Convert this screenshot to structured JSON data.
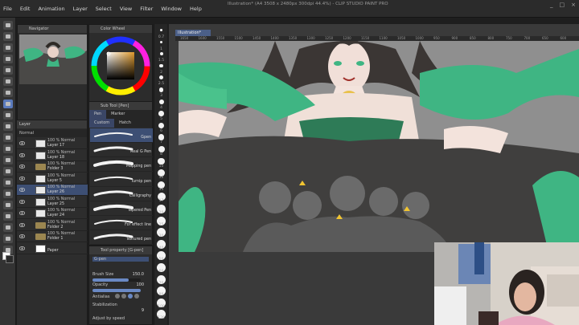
{
  "window": {
    "title": "Illustration* (A4 3508 x 2480px 300dpi 44.4%) - CLIP STUDIO PAINT PRO",
    "controls": [
      "_",
      "□",
      "×"
    ]
  },
  "menu": [
    "File",
    "Edit",
    "Animation",
    "Layer",
    "Select",
    "View",
    "Filter",
    "Window",
    "Help"
  ],
  "navigator": {
    "title": "Navigator"
  },
  "color_panel": {
    "title": "Color Wheel"
  },
  "sub_tool": {
    "title": "Sub Tool [Pen]",
    "tabs": [
      "Pen",
      "Marker"
    ],
    "row2": [
      "Custom",
      "Hatch"
    ],
    "brushes": [
      "Gpen",
      "Real G Pen",
      "Mapping pen",
      "Turnip pen",
      "Calligraphy",
      "Tapered Pen",
      "For effect line",
      "Textured pen"
    ]
  },
  "tool_property": {
    "title": "Tool property [G-pen]",
    "preset": "G-pen",
    "brush_size_label": "Brush Size",
    "brush_size": "150.0",
    "opacity_label": "Opacity",
    "opacity": "100",
    "opacity_fraction": 1.0,
    "brush_size_fraction": 0.75,
    "antialias_label": "Antialias",
    "stabilization_label": "Stabilization",
    "stabilization": "9",
    "adjust_label": "Adjust by speed"
  },
  "layers": {
    "title": "Layer",
    "blend_mode": "Normal",
    "items": [
      {
        "line1": "100 % Normal",
        "line2": "Layer 17",
        "kind": "layer"
      },
      {
        "line1": "100 % Normal",
        "line2": "Layer 18",
        "kind": "layer"
      },
      {
        "line1": "100 % Normal",
        "line2": "Folder 3",
        "kind": "folder"
      },
      {
        "line1": "100 % Normal",
        "line2": "Layer 5",
        "kind": "layer"
      },
      {
        "line1": "100 % Normal",
        "line2": "Layer 26",
        "kind": "layer",
        "selected": true
      },
      {
        "line1": "100 % Normal",
        "line2": "Layer 25",
        "kind": "layer"
      },
      {
        "line1": "100 % Normal",
        "line2": "Layer 24",
        "kind": "layer"
      },
      {
        "line1": "100 % Normal",
        "line2": "Folder 2",
        "kind": "folder"
      },
      {
        "line1": "100 % Normal",
        "line2": "Folder 1",
        "kind": "folder"
      },
      {
        "line1": "",
        "line2": "Paper",
        "kind": "paper"
      }
    ]
  },
  "size_strip": [
    "0.7",
    "1",
    "1.5",
    "2",
    "2.5",
    "3",
    "4",
    "5",
    "6",
    "7",
    "8",
    "10",
    "12",
    "15",
    "17",
    "20",
    "25",
    "30",
    "40",
    "50",
    "60",
    "70",
    "80",
    "100",
    "120"
  ],
  "canvas": {
    "tab": "Illustration*",
    "ruler_marks": [
      "1650",
      "1600",
      "1550",
      "1500",
      "1450",
      "1400",
      "1350",
      "1300",
      "1250",
      "1200",
      "1150",
      "1100",
      "1050",
      "1000",
      "950",
      "900",
      "850",
      "800",
      "750",
      "700",
      "650",
      "600"
    ]
  },
  "colors": {
    "accent": "#4b5f88",
    "canvas_bg": "#8f8f8f",
    "green_cloth": "#3fb583",
    "dark_shadow": "#3f3e3d"
  }
}
